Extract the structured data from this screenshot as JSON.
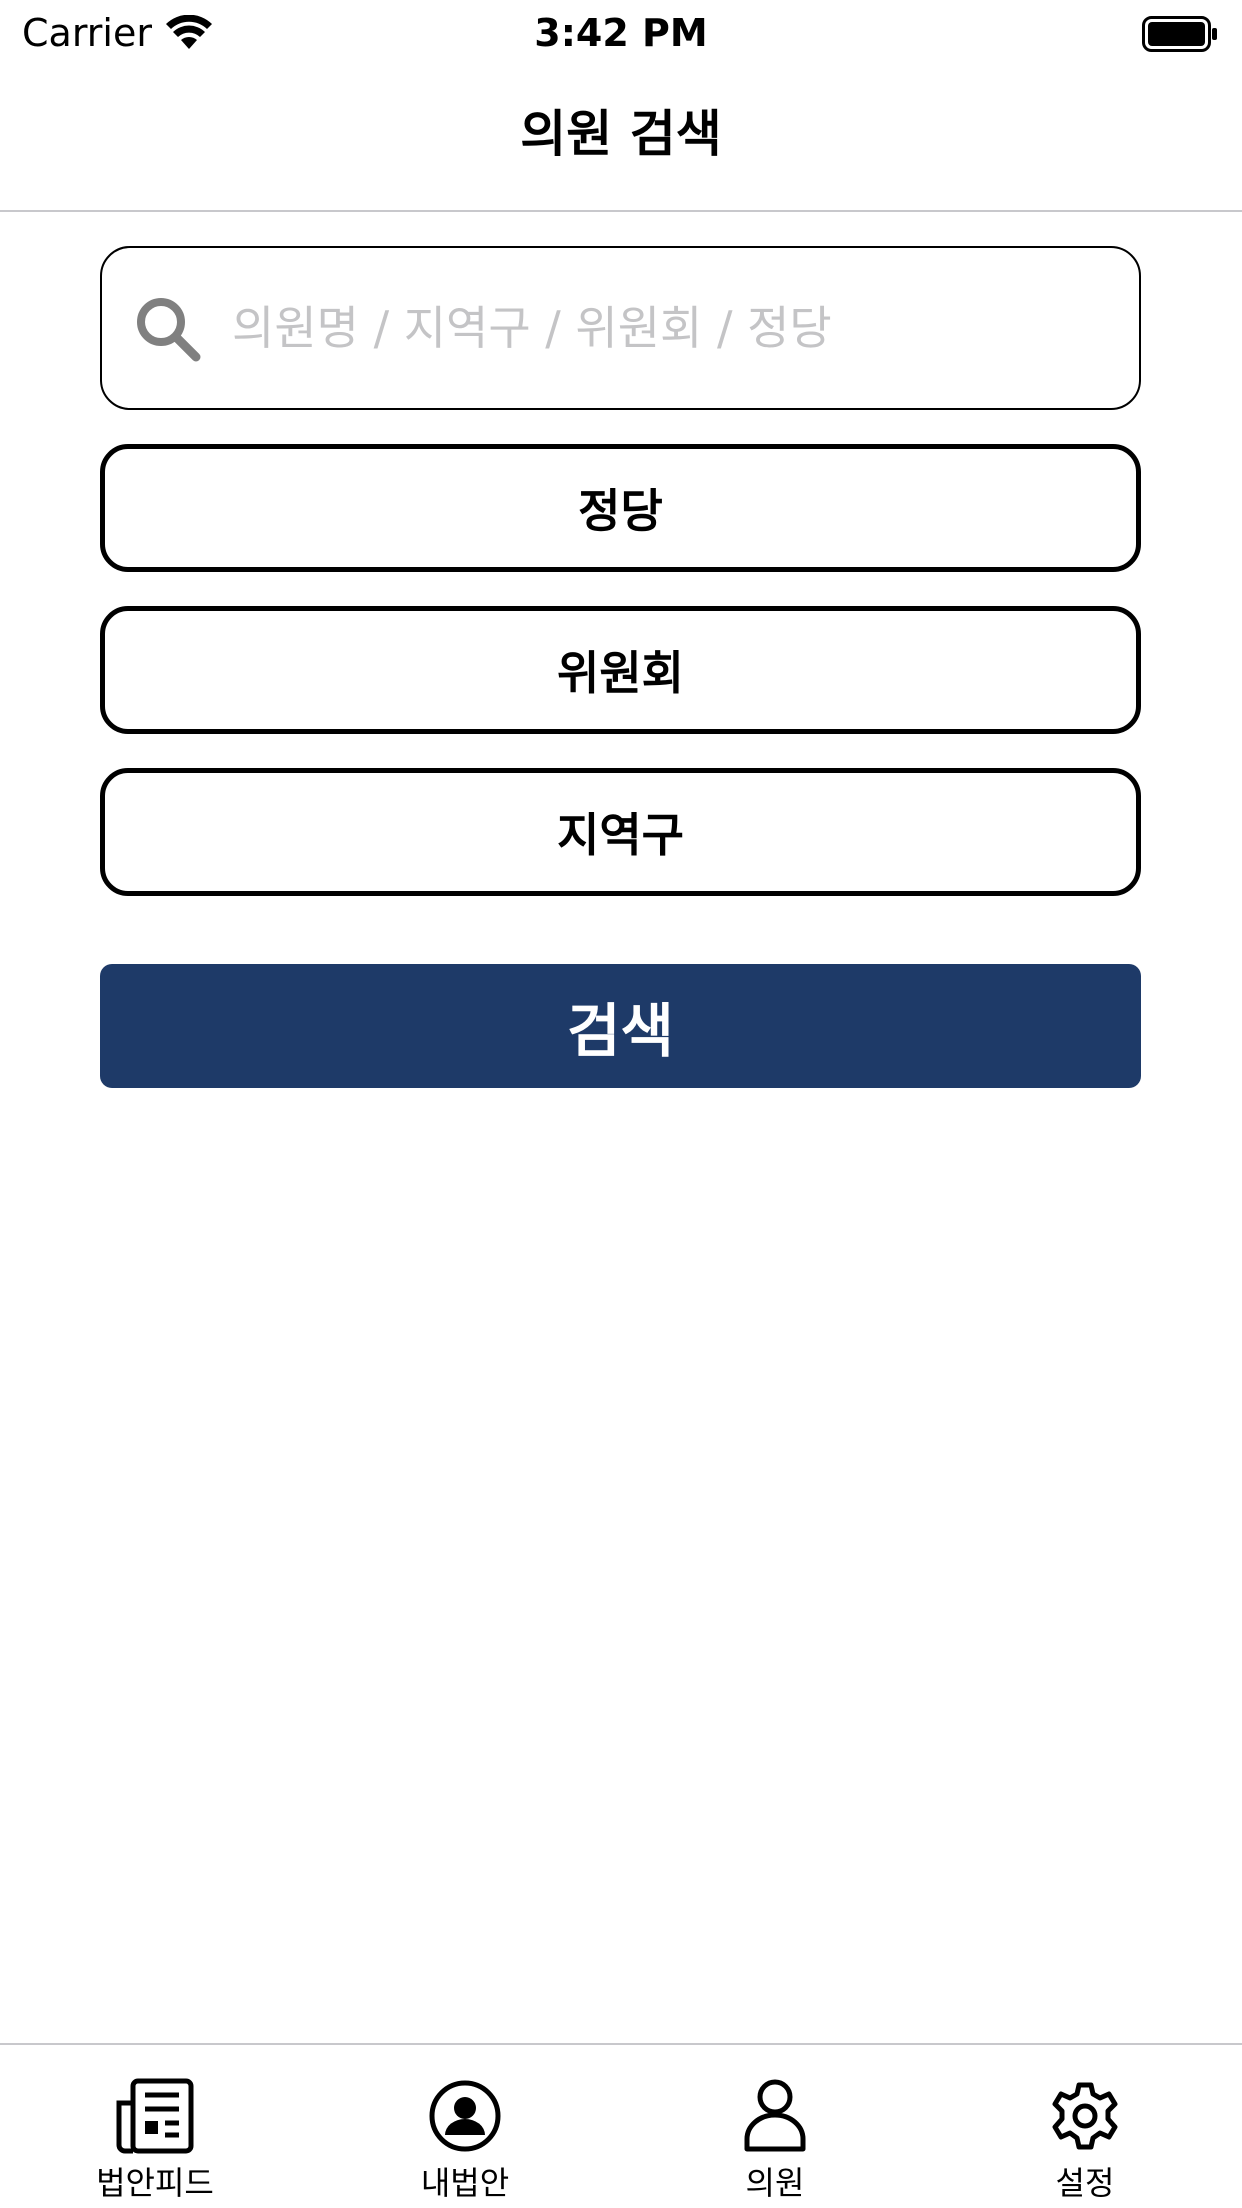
{
  "status_bar": {
    "carrier": "Carrier",
    "time": "3:42 PM",
    "wifi_icon": "wifi-icon",
    "battery_icon": "battery-icon"
  },
  "nav": {
    "title": "의원 검색"
  },
  "search": {
    "value": "",
    "placeholder": "의원명 / 지역구 / 위원회 / 정당",
    "icon": "search-icon"
  },
  "filters": {
    "party_label": "정당",
    "committee_label": "위원회",
    "district_label": "지역구"
  },
  "search_button": {
    "label": "검색",
    "color": "#1e3a68"
  },
  "tab_bar": {
    "items": [
      {
        "label": "법안피드",
        "icon": "newspaper-icon"
      },
      {
        "label": "내법안",
        "icon": "person-circle-icon"
      },
      {
        "label": "의원",
        "icon": "person-icon"
      },
      {
        "label": "설정",
        "icon": "gear-icon"
      }
    ]
  }
}
